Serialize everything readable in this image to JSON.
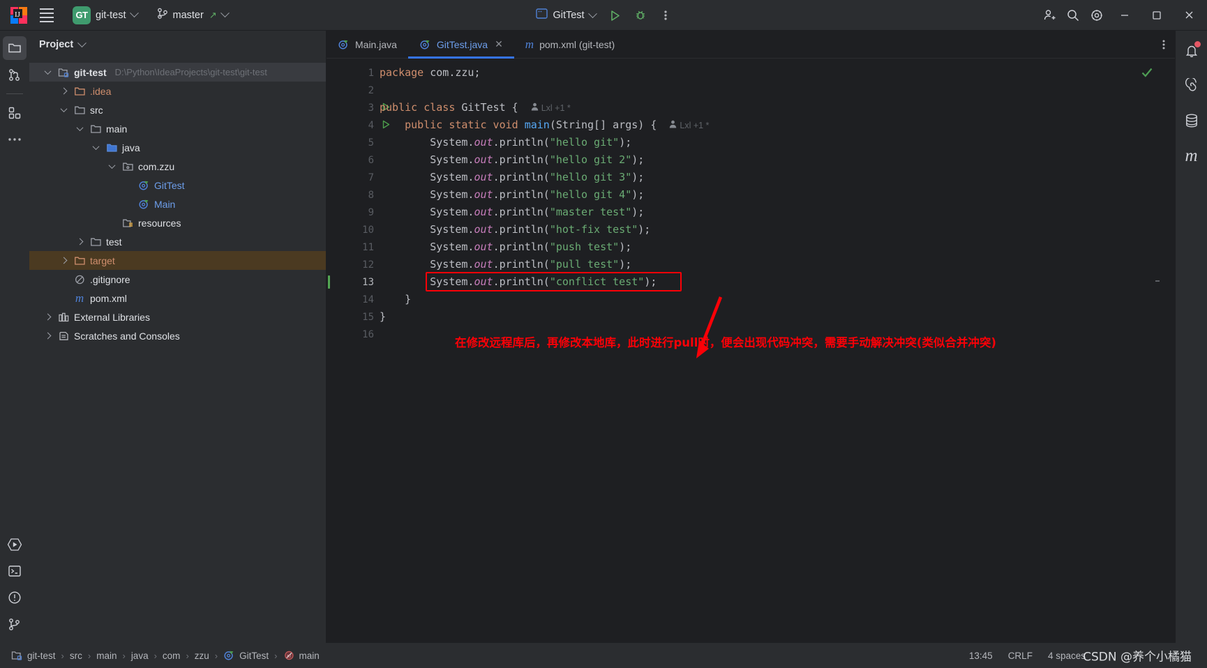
{
  "titlebar": {
    "app_icon": "intellij-idea-logo",
    "menu_icon": "hamburger-menu-icon",
    "project_badge": "GT",
    "project_name": "git-test",
    "vcs_icon": "git-branch-icon",
    "branch_name": "master",
    "branch_updated_icon": "arrow-up-right-icon",
    "run_config_icon": "run-configuration-icon",
    "run_config_name": "GitTest",
    "run_icon": "run-play-icon",
    "debug_icon": "debug-bug-icon",
    "more_icon": "more-vertical-icon",
    "share_icon": "add-user-icon",
    "search_icon": "search-icon",
    "settings_icon": "gear-icon",
    "minimize_icon": "minimize-icon",
    "maximize_icon": "maximize-icon",
    "close_icon": "close-icon"
  },
  "left_rail": [
    {
      "name": "project",
      "icon": "folder-icon",
      "active": true
    },
    {
      "name": "commit",
      "icon": "git-commit-icon",
      "active": false
    },
    {
      "name": "structure",
      "icon": "structure-blocks-icon",
      "active": false
    },
    {
      "name": "more-tool-windows",
      "icon": "ellipsis-icon",
      "active": false
    },
    {
      "name": "run",
      "icon": "run-hexagon-icon",
      "active": false
    },
    {
      "name": "terminal",
      "icon": "terminal-icon",
      "active": false
    },
    {
      "name": "problems",
      "icon": "warning-circle-icon",
      "active": false
    },
    {
      "name": "version-control",
      "icon": "git-branch-icon",
      "active": false
    }
  ],
  "right_rail": [
    {
      "name": "notifications",
      "icon": "bell-icon",
      "badge": true
    },
    {
      "name": "ai-assistant",
      "icon": "spiral-icon",
      "badge": false
    },
    {
      "name": "database",
      "icon": "database-icon",
      "badge": false
    },
    {
      "name": "maven",
      "icon": "maven-m-icon",
      "badge": false
    }
  ],
  "project_panel": {
    "title": "Project",
    "title_chevron": "chevron-down-icon",
    "tree": [
      {
        "label": "git-test",
        "sub": "D:\\Python\\IdeaProjects\\git-test\\git-test",
        "depth": 0,
        "arrow": "down",
        "icon": "module-icon",
        "color": "white",
        "bold": true,
        "state": "selected"
      },
      {
        "label": ".idea",
        "sub": "",
        "depth": 1,
        "arrow": "right",
        "icon": "folder-icon",
        "color": "orange",
        "bold": false,
        "state": ""
      },
      {
        "label": "src",
        "sub": "",
        "depth": 1,
        "arrow": "down",
        "icon": "folder-icon",
        "color": "white",
        "bold": false,
        "state": ""
      },
      {
        "label": "main",
        "sub": "",
        "depth": 2,
        "arrow": "down",
        "icon": "folder-icon",
        "color": "white",
        "bold": false,
        "state": ""
      },
      {
        "label": "java",
        "sub": "",
        "depth": 3,
        "arrow": "down",
        "icon": "source-folder-icon",
        "color": "white",
        "bold": false,
        "state": ""
      },
      {
        "label": "com.zzu",
        "sub": "",
        "depth": 4,
        "arrow": "down",
        "icon": "package-icon",
        "color": "white",
        "bold": false,
        "state": ""
      },
      {
        "label": "GitTest",
        "sub": "",
        "depth": 5,
        "arrow": "none",
        "icon": "java-class-runnable-icon",
        "color": "blue",
        "bold": false,
        "state": ""
      },
      {
        "label": "Main",
        "sub": "",
        "depth": 5,
        "arrow": "none",
        "icon": "java-class-runnable-icon",
        "color": "blue",
        "bold": false,
        "state": ""
      },
      {
        "label": "resources",
        "sub": "",
        "depth": 4,
        "arrow": "none",
        "icon": "resources-folder-icon",
        "color": "white",
        "bold": false,
        "state": ""
      },
      {
        "label": "test",
        "sub": "",
        "depth": 2,
        "arrow": "right",
        "icon": "folder-icon",
        "color": "white",
        "bold": false,
        "state": ""
      },
      {
        "label": "target",
        "sub": "",
        "depth": 1,
        "arrow": "right",
        "icon": "folder-icon",
        "color": "orange",
        "bold": false,
        "state": "target"
      },
      {
        "label": ".gitignore",
        "sub": "",
        "depth": 1,
        "arrow": "none",
        "icon": "gitignore-icon",
        "color": "white",
        "bold": false,
        "state": ""
      },
      {
        "label": "pom.xml",
        "sub": "",
        "depth": 1,
        "arrow": "none",
        "icon": "maven-m-icon",
        "color": "white",
        "bold": false,
        "state": ""
      },
      {
        "label": "External Libraries",
        "sub": "",
        "depth": 0,
        "arrow": "right",
        "icon": "libraries-icon",
        "color": "white",
        "bold": false,
        "state": ""
      },
      {
        "label": "Scratches and Consoles",
        "sub": "",
        "depth": 0,
        "arrow": "right",
        "icon": "scratches-icon",
        "color": "white",
        "bold": false,
        "state": ""
      }
    ]
  },
  "editor": {
    "tabs": [
      {
        "label": "Main.java",
        "icon": "java-class-runnable-icon",
        "active": false,
        "closable": false
      },
      {
        "label": "GitTest.java",
        "icon": "java-class-runnable-icon",
        "active": true,
        "closable": true
      },
      {
        "label": "pom.xml (git-test)",
        "icon": "maven-m-icon",
        "active": false,
        "closable": false
      }
    ],
    "tab_close_icon": "close-icon",
    "tabbar_more_icon": "more-vertical-icon",
    "inspection_status_icon": "checkmark-ok-icon",
    "line_numbers": [
      1,
      2,
      3,
      4,
      5,
      6,
      7,
      8,
      9,
      10,
      11,
      12,
      13,
      14,
      15,
      16
    ],
    "run_marker_lines": [
      3,
      4
    ],
    "vcs_change_lines": [
      13
    ],
    "gutter_annotations": [
      {
        "line": 3,
        "text": "Lxl +1 *",
        "icon": "person-icon"
      },
      {
        "line": 4,
        "text": "Lxl +1 *",
        "icon": "person-icon"
      }
    ],
    "code_lines": [
      {
        "n": 1,
        "tokens": [
          {
            "t": "package ",
            "c": "k"
          },
          {
            "t": "com.zzu;",
            "c": "p"
          }
        ]
      },
      {
        "n": 2,
        "tokens": []
      },
      {
        "n": 3,
        "tokens": [
          {
            "t": "public class ",
            "c": "k"
          },
          {
            "t": "GitTest {",
            "c": "p"
          }
        ]
      },
      {
        "n": 4,
        "tokens": [
          {
            "t": "    public static void ",
            "c": "k"
          },
          {
            "t": "main",
            "c": "m"
          },
          {
            "t": "(String[] args) {",
            "c": "p"
          }
        ]
      },
      {
        "n": 5,
        "tokens": [
          {
            "t": "        System.",
            "c": "p"
          },
          {
            "t": "out",
            "c": "id"
          },
          {
            "t": ".println(",
            "c": "p"
          },
          {
            "t": "\"hello git\"",
            "c": "s"
          },
          {
            "t": ");",
            "c": "p"
          }
        ]
      },
      {
        "n": 6,
        "tokens": [
          {
            "t": "        System.",
            "c": "p"
          },
          {
            "t": "out",
            "c": "id"
          },
          {
            "t": ".println(",
            "c": "p"
          },
          {
            "t": "\"hello git 2\"",
            "c": "s"
          },
          {
            "t": ");",
            "c": "p"
          }
        ]
      },
      {
        "n": 7,
        "tokens": [
          {
            "t": "        System.",
            "c": "p"
          },
          {
            "t": "out",
            "c": "id"
          },
          {
            "t": ".println(",
            "c": "p"
          },
          {
            "t": "\"hello git 3\"",
            "c": "s"
          },
          {
            "t": ");",
            "c": "p"
          }
        ]
      },
      {
        "n": 8,
        "tokens": [
          {
            "t": "        System.",
            "c": "p"
          },
          {
            "t": "out",
            "c": "id"
          },
          {
            "t": ".println(",
            "c": "p"
          },
          {
            "t": "\"hello git 4\"",
            "c": "s"
          },
          {
            "t": ");",
            "c": "p"
          }
        ]
      },
      {
        "n": 9,
        "tokens": [
          {
            "t": "        System.",
            "c": "p"
          },
          {
            "t": "out",
            "c": "id"
          },
          {
            "t": ".println(",
            "c": "p"
          },
          {
            "t": "\"master test\"",
            "c": "s"
          },
          {
            "t": ");",
            "c": "p"
          }
        ]
      },
      {
        "n": 10,
        "tokens": [
          {
            "t": "        System.",
            "c": "p"
          },
          {
            "t": "out",
            "c": "id"
          },
          {
            "t": ".println(",
            "c": "p"
          },
          {
            "t": "\"hot-fix test\"",
            "c": "s"
          },
          {
            "t": ");",
            "c": "p"
          }
        ]
      },
      {
        "n": 11,
        "tokens": [
          {
            "t": "        System.",
            "c": "p"
          },
          {
            "t": "out",
            "c": "id"
          },
          {
            "t": ".println(",
            "c": "p"
          },
          {
            "t": "\"push test\"",
            "c": "s"
          },
          {
            "t": ");",
            "c": "p"
          }
        ]
      },
      {
        "n": 12,
        "tokens": [
          {
            "t": "        System.",
            "c": "p"
          },
          {
            "t": "out",
            "c": "id"
          },
          {
            "t": ".println(",
            "c": "p"
          },
          {
            "t": "\"pull test\"",
            "c": "s"
          },
          {
            "t": ");",
            "c": "p"
          }
        ]
      },
      {
        "n": 13,
        "tokens": [
          {
            "t": "        System.",
            "c": "p"
          },
          {
            "t": "out",
            "c": "id"
          },
          {
            "t": ".println(",
            "c": "p"
          },
          {
            "t": "\"conflict test\"",
            "c": "s"
          },
          {
            "t": ");",
            "c": "p"
          }
        ]
      },
      {
        "n": 14,
        "tokens": [
          {
            "t": "    }",
            "c": "p"
          }
        ]
      },
      {
        "n": 15,
        "tokens": [
          {
            "t": "}",
            "c": "p"
          }
        ]
      },
      {
        "n": 16,
        "tokens": []
      }
    ],
    "annotation": {
      "text": "在修改远程库后，再修改本地库，此时进行pull时，便会出现代码冲突，需要手动解决冲突(类似合并冲突)",
      "color": "#fb0007",
      "arrow_icon": "red-arrow-down-icon",
      "highlight_color": "#fb0007"
    }
  },
  "statusbar": {
    "breadcrumbs": [
      {
        "label": "git-test",
        "icon": "module-icon"
      },
      {
        "label": "src",
        "icon": ""
      },
      {
        "label": "main",
        "icon": ""
      },
      {
        "label": "java",
        "icon": ""
      },
      {
        "label": "com",
        "icon": ""
      },
      {
        "label": "zzu",
        "icon": ""
      },
      {
        "label": "GitTest",
        "icon": "java-class-runnable-icon"
      },
      {
        "label": "main",
        "icon": "method-icon"
      }
    ],
    "separator": "›",
    "caret_time": "13:45",
    "line_separator": "CRLF",
    "indent": "4 spaces",
    "watermark": "CSDN @养个小橘猫"
  },
  "colors": {
    "accent_blue": "#3574f0",
    "annotation_red": "#fb0007",
    "git_green": "#53a653",
    "panel_bg": "#2b2d30",
    "editor_bg": "#1e1f22"
  }
}
